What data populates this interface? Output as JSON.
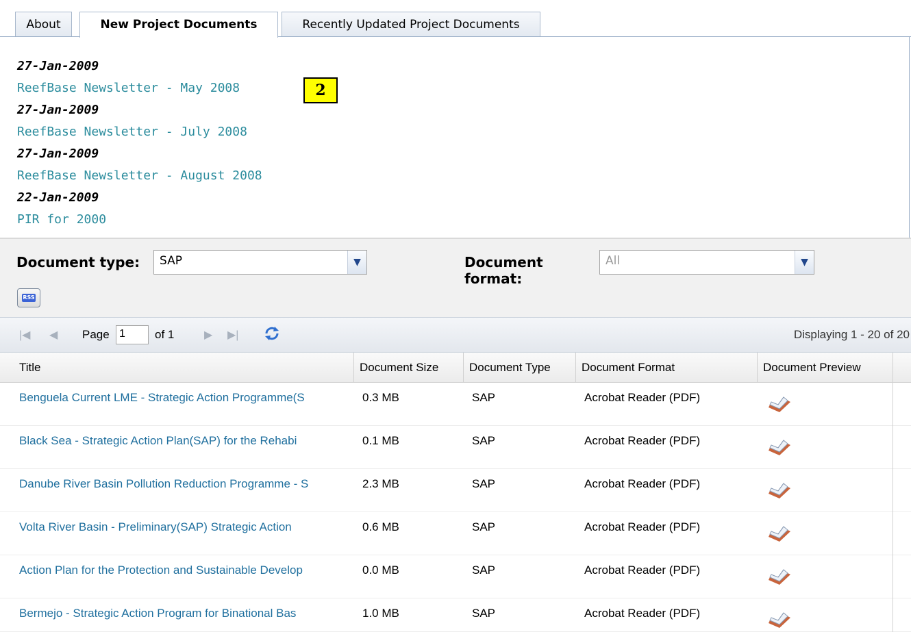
{
  "tabs": [
    {
      "label": "About"
    },
    {
      "label": "New Project Documents"
    },
    {
      "label": "Recently Updated Project Documents"
    }
  ],
  "new_documents": [
    {
      "date": "27-Jan-2009",
      "title": "ReefBase Newsletter - May 2008"
    },
    {
      "date": "27-Jan-2009",
      "title": "ReefBase Newsletter - July 2008"
    },
    {
      "date": "27-Jan-2009",
      "title": "ReefBase Newsletter - August 2008"
    },
    {
      "date": "22-Jan-2009",
      "title": "PIR for 2000"
    }
  ],
  "marker_label": "2",
  "filters": {
    "doc_type_label": "Document type:",
    "doc_type_value": "SAP",
    "doc_format_label_line1": "Document",
    "doc_format_label_line2": "format:",
    "doc_format_value": "All",
    "rss_label": "RSS"
  },
  "pager": {
    "page_label": "Page",
    "page_value": "1",
    "of_label": "of 1",
    "display_info": "Displaying 1 - 20 of 20"
  },
  "grid": {
    "columns": [
      "Title",
      "Document Size",
      "Document Type",
      "Document Format",
      "Document Preview"
    ],
    "rows": [
      {
        "title": "Benguela Current LME - Strategic Action Programme(S",
        "size": "0.3 MB",
        "type": "SAP",
        "format": "Acrobat Reader (PDF)"
      },
      {
        "title": "Black Sea - Strategic Action Plan(SAP) for the Rehabi",
        "size": "0.1 MB",
        "type": "SAP",
        "format": "Acrobat Reader (PDF)"
      },
      {
        "title": "Danube River Basin Pollution Reduction Programme - S",
        "size": "2.3 MB",
        "type": "SAP",
        "format": "Acrobat Reader (PDF)"
      },
      {
        "title": "Volta River Basin - Preliminary(SAP) Strategic Action",
        "size": "0.6 MB",
        "type": "SAP",
        "format": "Acrobat Reader (PDF)"
      },
      {
        "title": "Action Plan for the Protection and Sustainable Develop",
        "size": "0.0 MB",
        "type": "SAP",
        "format": "Acrobat Reader (PDF)"
      },
      {
        "title": "Bermejo - Strategic Action Program for Binational Bas",
        "size": "1.0 MB",
        "type": "SAP",
        "format": "Acrobat Reader (PDF)"
      }
    ]
  },
  "icons": {
    "combo_arrow": "chevron-down-icon",
    "pager_first": "first-page-icon",
    "pager_prev": "prev-page-icon",
    "pager_next": "next-page-icon",
    "pager_last": "last-page-icon",
    "pager_refresh": "refresh-icon",
    "preview": "book-preview-icon"
  },
  "colors": {
    "link": "#2b8c9d",
    "grid_link": "#1f6f9e",
    "marker_bg": "#ffff00",
    "rss_blue": "#3b63d6"
  }
}
